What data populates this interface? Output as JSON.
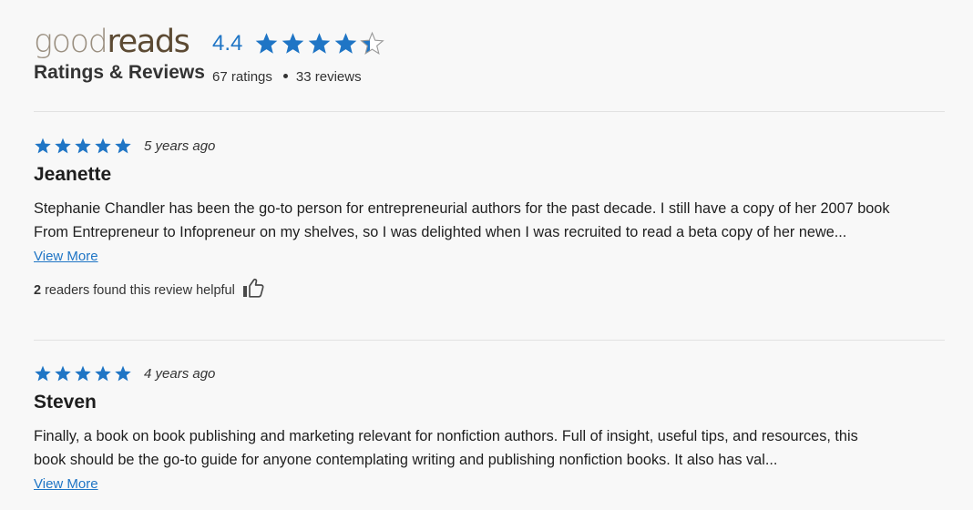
{
  "header": {
    "logo_left": "good",
    "logo_right": "reads",
    "title": "Ratings & Reviews",
    "average_rating": "4.4",
    "average_rating_value": 4.4,
    "ratings_count": "67 ratings",
    "reviews_count": "33 reviews"
  },
  "colors": {
    "star": "#1f75c5",
    "star_empty": "#ffffff",
    "star_empty_outline": "#9a9a9a",
    "link": "#1f75c5",
    "divider": "#e2e2e2"
  },
  "icons": {
    "star": "star-icon",
    "thumb": "thumbs-up-icon"
  },
  "reviews": [
    {
      "stars": 5,
      "date": "5 years ago",
      "reviewer": "Jeanette",
      "body_line1": "Stephanie Chandler has been the go-to person for entrepreneurial authors for the past decade. I still have a copy of her 2007 book",
      "body_line2": "From Entrepreneur to Infopreneur on my shelves, so I was delighted when I was recruited to read a beta copy of her newe...",
      "view_more": "View More",
      "helpful_count": "2",
      "helpful_text": "readers found this review helpful"
    },
    {
      "stars": 5,
      "date": "4 years ago",
      "reviewer": "Steven",
      "body_line1": "Finally, a book on book publishing and marketing relevant for nonfiction authors. Full of insight, useful tips, and resources, this",
      "body_line2": "book should be the go-to guide for anyone contemplating writing and publishing nonfiction books. It also has val...",
      "view_more": "View More"
    }
  ]
}
